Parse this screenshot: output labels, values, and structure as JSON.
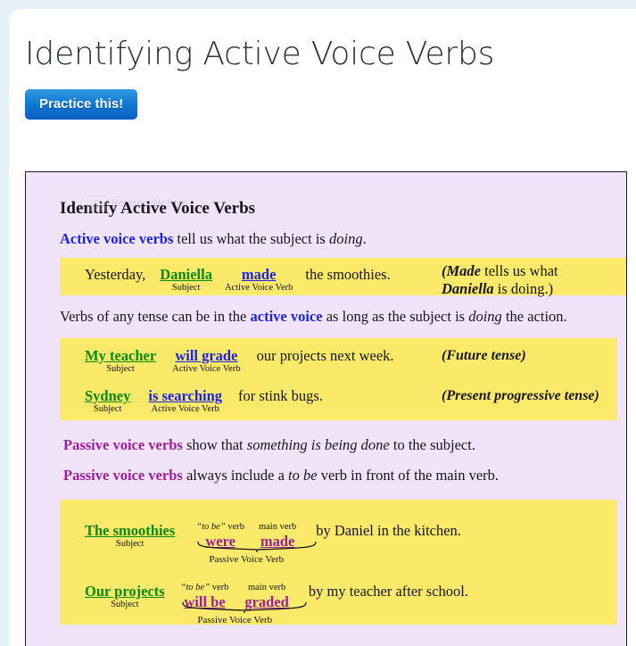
{
  "page": {
    "title": "Identifying Active Voice Verbs",
    "practice_button": "Practice this!",
    "accent_blue": "#1279d4",
    "panel_bg": "#f0e3fa",
    "example_box_bg": "#fbe96a",
    "subject_color": "#0a8a10",
    "active_verb_color": "#1b23e8",
    "passive_verb_color": "#9c1f9c"
  },
  "snip_overlay": {
    "label": "Rectangular Snip",
    "icon": "camera-icon"
  },
  "lesson": {
    "heading": "Identify Active Voice Verbs",
    "intro": {
      "keyword": "Active voice verbs",
      "rest_before_italic": " tell us what the subject is ",
      "italic": "doing",
      "rest_after_italic": "."
    },
    "example_box_1": {
      "lead": "Yesterday,",
      "subject": {
        "word": "Daniella",
        "label": "Subject"
      },
      "verb": {
        "word": "made",
        "label": "Active Voice Verb"
      },
      "tail": "the smoothies.",
      "note_line_1_bold": "Made",
      "note_line_1_rest": " tells us what",
      "note_line_2_bold": "Daniella",
      "note_line_2_rest": " is doing.)",
      "note_open_paren": "("
    },
    "tense_line": {
      "before": "Verbs of any tense can be in the ",
      "keyword": "active voice",
      "middle": " as long as the subject is ",
      "italic": "doing",
      "after": " the action."
    },
    "example_box_2": {
      "rows": [
        {
          "subject": {
            "word": "My teacher",
            "label": "Subject"
          },
          "verb": {
            "word": "will grade",
            "label": "Active Voice Verb"
          },
          "tail": "our projects next week.",
          "tense": "(Future tense)"
        },
        {
          "subject": {
            "word": "Sydney",
            "label": "Subject"
          },
          "verb": {
            "word": "is searching",
            "label": "Active Voice Verb"
          },
          "tail": "for stink bugs.",
          "tense": "(Present progressive tense)"
        }
      ]
    },
    "passive_line_1": {
      "keyword": "Passive voice verbs",
      "before_italic": " show that ",
      "italic": "something is being done",
      "after_italic": " to the subject."
    },
    "passive_line_2": {
      "keyword": "Passive voice verbs",
      "before_italic": " always include a ",
      "italic": "to be",
      "after_italic": " verb in front of the main verb."
    },
    "example_box_3": {
      "brace_label": "Passive Voice Verb",
      "to_be_label_italic": "to be",
      "to_be_label_rest": " verb",
      "main_verb_label": "main verb",
      "rows": [
        {
          "subject": {
            "word": "The smoothies",
            "label": "Subject"
          },
          "to_be": "were",
          "main_verb": "made",
          "tail": "by Daniel in the kitchen."
        },
        {
          "subject": {
            "word": "Our projects",
            "label": "Subject"
          },
          "to_be": "will be",
          "main_verb": "graded",
          "tail": "by my teacher after school."
        }
      ]
    }
  }
}
